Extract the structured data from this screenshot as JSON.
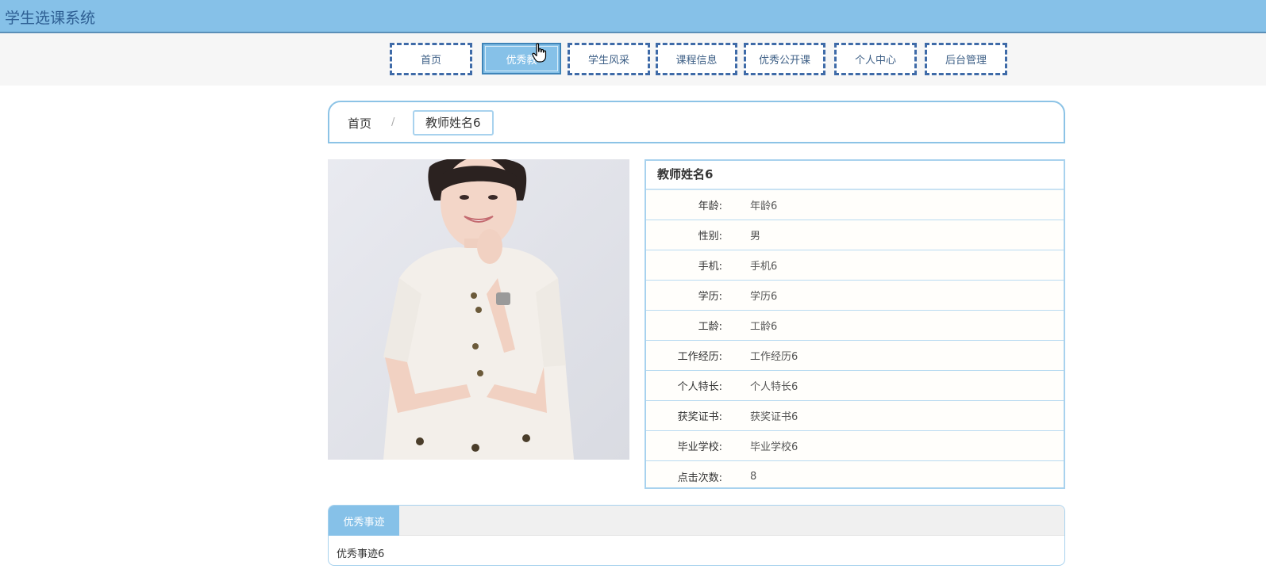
{
  "app": {
    "title": "学生选课系统"
  },
  "nav": {
    "items": [
      {
        "label": "首页"
      },
      {
        "label": "优秀教"
      },
      {
        "label": "学生风采"
      },
      {
        "label": "课程信息"
      },
      {
        "label": "优秀公开课"
      },
      {
        "label": "个人中心"
      },
      {
        "label": "后台管理"
      }
    ],
    "active_index": 1
  },
  "breadcrumb": {
    "home": "首页",
    "separator": "/",
    "current": "教师姓名6"
  },
  "teacher": {
    "name": "教师姓名6",
    "fields": [
      {
        "label": "年龄:",
        "value": "年龄6"
      },
      {
        "label": "性别:",
        "value": "男"
      },
      {
        "label": "手机:",
        "value": "手机6"
      },
      {
        "label": "学历:",
        "value": "学历6"
      },
      {
        "label": "工龄:",
        "value": "工龄6"
      },
      {
        "label": "工作经历:",
        "value": "工作经历6"
      },
      {
        "label": "个人特长:",
        "value": "个人特长6"
      },
      {
        "label": "获奖证书:",
        "value": "获奖证书6"
      },
      {
        "label": "毕业学校:",
        "value": "毕业学校6"
      },
      {
        "label": "点击次数:",
        "value": "8"
      }
    ]
  },
  "tabs": {
    "active_label": "优秀事迹",
    "content": "优秀事迹6"
  },
  "colors": {
    "accent": "#86c1e8",
    "header_text": "#2e5f93",
    "nav_border": "#3f6ba8"
  }
}
